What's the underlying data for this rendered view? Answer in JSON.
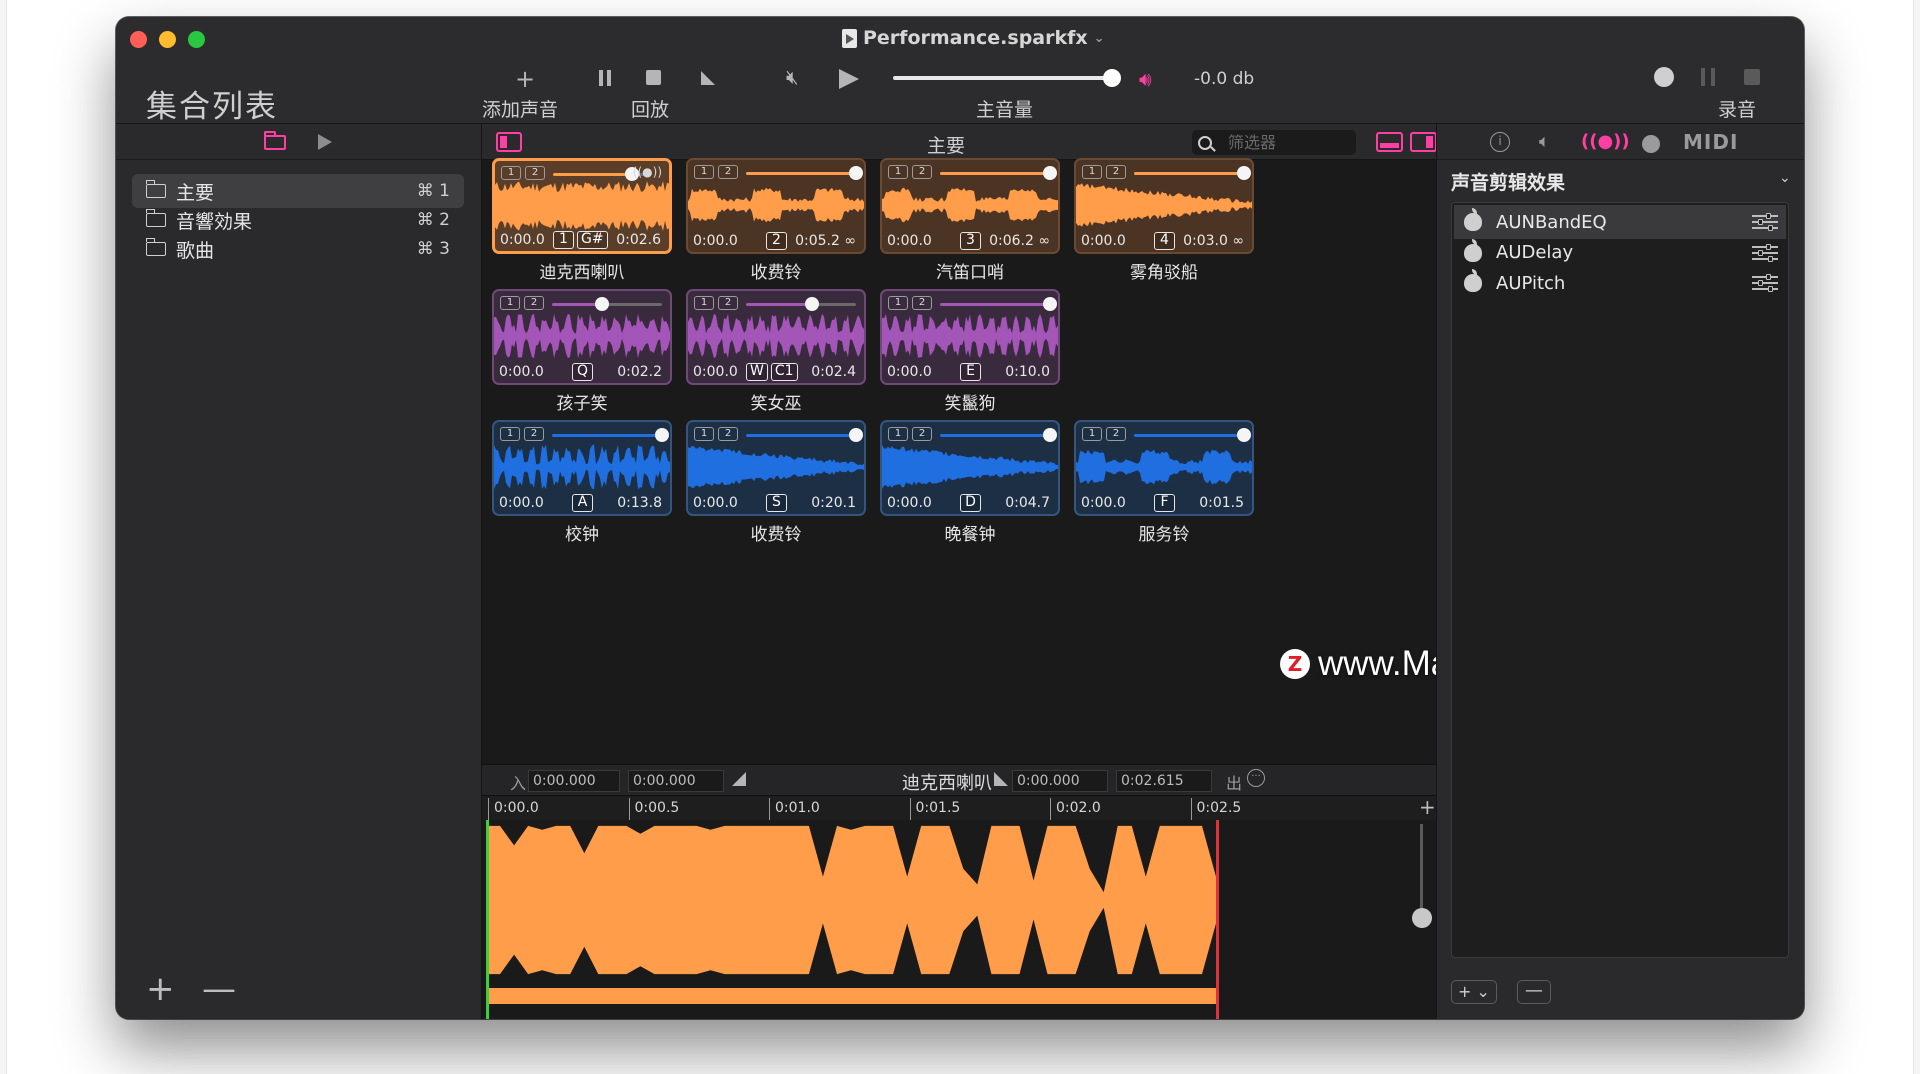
{
  "window": {
    "title": "Performance.sparkfx",
    "title_chevron": "⌄",
    "library_title": "集合列表"
  },
  "toolbar": {
    "add_icon": "+",
    "add_label": "添加声音",
    "playback_label": "回放",
    "master_volume_label": "主音量",
    "master_db": "-0.0 db",
    "record_label": "录音",
    "master_volume_level": 0.8,
    "accent_color": "#ff3fa4"
  },
  "sidebar": {
    "items": [
      {
        "label": "主要",
        "shortcut": "⌘ 1",
        "selected": true
      },
      {
        "label": "音響効果",
        "shortcut": "⌘ 2",
        "selected": false
      },
      {
        "label": "歌曲",
        "shortcut": "⌘ 3",
        "selected": false
      }
    ],
    "add_icon": "+",
    "remove_icon": "—"
  },
  "main": {
    "title": "主要",
    "filter_placeholder": "筛选器",
    "tiles": [
      {
        "name": "迪克西喇叭",
        "start": "0:00.0",
        "end": "0:02.6",
        "keys": [
          "1",
          "G#"
        ],
        "color": "orange",
        "level": 0.86,
        "active": true,
        "suffix": ""
      },
      {
        "name": "收费铃",
        "start": "0:00.0",
        "end": "0:05.2 ∞",
        "keys": [
          "2"
        ],
        "color": "orange",
        "level": 1.0,
        "active": false,
        "suffix": ""
      },
      {
        "name": "汽笛口哨",
        "start": "0:00.0",
        "end": "0:06.2 ∞",
        "keys": [
          "3"
        ],
        "color": "orange",
        "level": 1.0,
        "active": false,
        "suffix": ""
      },
      {
        "name": "雾角驳船",
        "start": "0:00.0",
        "end": "0:03.0 ∞",
        "keys": [
          "4"
        ],
        "color": "orange",
        "level": 1.0,
        "active": false,
        "suffix": ""
      },
      {
        "name": "孩子笑",
        "start": "0:00.0",
        "end": "0:02.2",
        "keys": [
          "Q"
        ],
        "color": "purple",
        "level": 0.45,
        "active": false
      },
      {
        "name": "笑女巫",
        "start": "0:00.0",
        "end": "0:02.4",
        "keys": [
          "W",
          "C1"
        ],
        "color": "purple",
        "level": 0.6,
        "active": false
      },
      {
        "name": "笑鬣狗",
        "start": "0:00.0",
        "end": "0:10.0",
        "keys": [
          "E"
        ],
        "color": "purple",
        "level": 1.0,
        "active": false
      },
      {
        "name": "校钟",
        "start": "0:00.0",
        "end": "0:13.8",
        "keys": [
          "A"
        ],
        "color": "blue",
        "level": 1.0,
        "active": false
      },
      {
        "name": "收费铃",
        "start": "0:00.0",
        "end": "0:20.1",
        "keys": [
          "S"
        ],
        "color": "blue",
        "level": 1.0,
        "active": false
      },
      {
        "name": "晚餐钟",
        "start": "0:00.0",
        "end": "0:04.7",
        "keys": [
          "D"
        ],
        "color": "blue",
        "level": 1.0,
        "active": false
      },
      {
        "name": "服务铃",
        "start": "0:00.0",
        "end": "0:01.5",
        "keys": [
          "F"
        ],
        "color": "blue",
        "level": 1.0,
        "active": false
      }
    ],
    "channel_chips": [
      "1",
      "2"
    ],
    "watermark_logo": "Z",
    "watermark_text": "www.MacZ.com"
  },
  "editor": {
    "title": "迪克西喇叭",
    "in_start": "0:00.000",
    "in_end": "0:00.000",
    "out_start": "0:00.000",
    "out_end": "0:02.615",
    "in_symbol": "入",
    "out_symbol": "出",
    "ticks": [
      "0:00.0",
      "0:00.5",
      "0:01.0",
      "0:01.5",
      "0:02.0",
      "0:02.5"
    ],
    "add_icon": "+"
  },
  "inspector": {
    "section_title": "声音剪辑效果",
    "section_chevron": "⌄",
    "midi_label": "MIDI",
    "info_icon": "i",
    "effects": [
      {
        "label": "AUNBandEQ",
        "selected": true
      },
      {
        "label": "AUDelay",
        "selected": false
      },
      {
        "label": "AUPitch",
        "selected": false
      }
    ],
    "add_button": "+ ⌄",
    "remove_button": "—"
  },
  "colors": {
    "orange": "#ff9d4a",
    "purple": "#a455b8",
    "blue": "#1f6fe0",
    "pink_accent": "#ff3fa4"
  }
}
